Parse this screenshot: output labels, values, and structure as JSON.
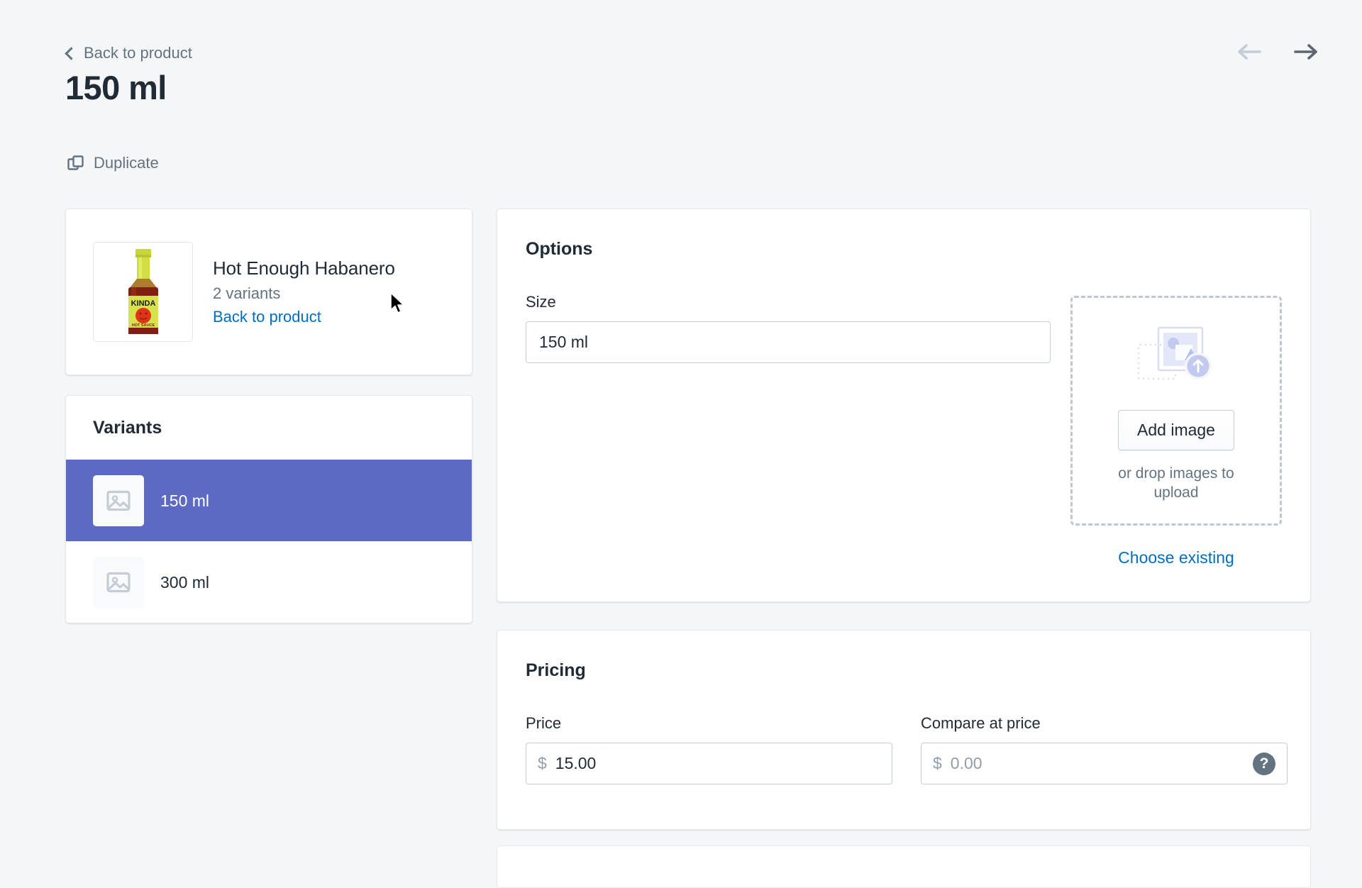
{
  "header": {
    "back_link": "Back to product",
    "back_chevron_icon": "chevron-left-icon",
    "title": "150 ml",
    "duplicate_label": "Duplicate",
    "duplicate_icon": "duplicate-icon",
    "prev_icon": "arrow-left-icon",
    "next_icon": "arrow-right-icon",
    "prev_enabled": false,
    "next_enabled": true
  },
  "product_card": {
    "thumbnail_icon": "product-bottle-thumbnail",
    "thumbnail_alt": "KINDA Hot Sauce bottle",
    "title": "Hot Enough Habanero",
    "variant_count": "2 variants",
    "back_link": "Back to product"
  },
  "variants": {
    "heading": "Variants",
    "items": [
      {
        "label": "150 ml",
        "selected": true,
        "thumb_icon": "image-placeholder-icon"
      },
      {
        "label": "300 ml",
        "selected": false,
        "thumb_icon": "image-placeholder-icon"
      }
    ]
  },
  "options": {
    "heading": "Options",
    "size_label": "Size",
    "size_value": "150 ml",
    "size_placeholder": "",
    "dropzone": {
      "illustration_icon": "image-upload-illustration",
      "button_label": "Add image",
      "hint": "or drop images to upload",
      "choose_existing": "Choose existing"
    }
  },
  "pricing": {
    "heading": "Pricing",
    "price_label": "Price",
    "price_currency": "$",
    "price_value": "15.00",
    "compare_label": "Compare at price",
    "compare_currency": "$",
    "compare_value": "",
    "compare_placeholder": "0.00",
    "help_icon": "help-question-icon",
    "help_glyph": "?"
  },
  "colors": {
    "page_bg": "#f4f6f8",
    "selected_variant": "#5c6ac4",
    "link": "#006fbb",
    "text": "#212b36",
    "subdued": "#637381",
    "border": "#c4cdd5"
  }
}
